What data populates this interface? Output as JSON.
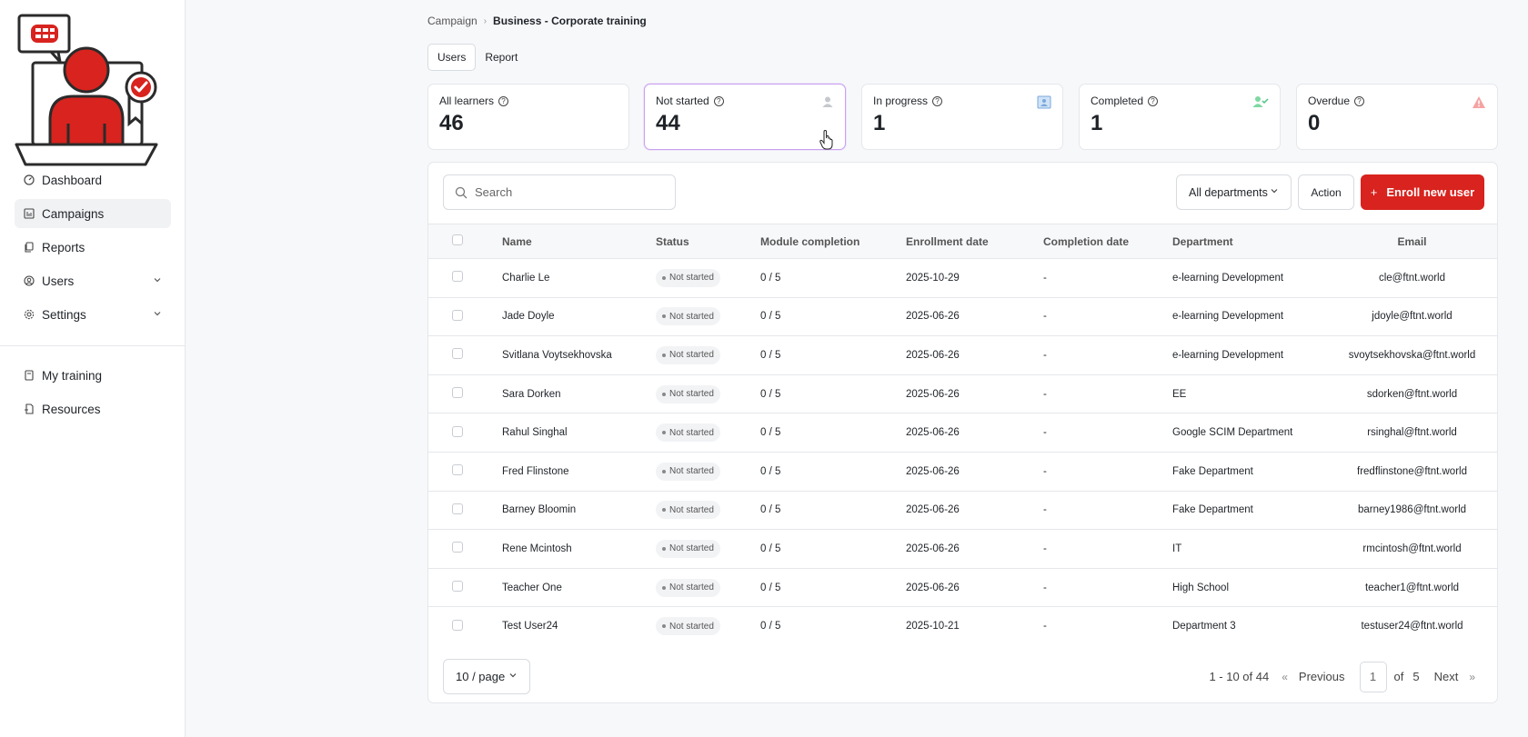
{
  "sidebar": {
    "items": [
      {
        "label": "Dashboard",
        "icon": "gauge-icon"
      },
      {
        "label": "Campaigns",
        "icon": "bar-chart-icon"
      },
      {
        "label": "Reports",
        "icon": "copy-icon"
      },
      {
        "label": "Users",
        "icon": "user-circle-icon"
      },
      {
        "label": "Settings",
        "icon": "gear-icon"
      }
    ],
    "secondary": [
      {
        "label": "My training",
        "icon": "book-icon"
      },
      {
        "label": "Resources",
        "icon": "file-icon"
      }
    ]
  },
  "breadcrumb": {
    "root": "Campaign",
    "current": "Business - Corporate training"
  },
  "tabs": [
    {
      "label": "Users"
    },
    {
      "label": "Report"
    }
  ],
  "stats": [
    {
      "label": "All learners",
      "value": "46"
    },
    {
      "label": "Not started",
      "value": "44"
    },
    {
      "label": "In progress",
      "value": "1"
    },
    {
      "label": "Completed",
      "value": "1"
    },
    {
      "label": "Overdue",
      "value": "0"
    }
  ],
  "toolbar": {
    "search_placeholder": "Search",
    "dept_label": "All departments",
    "action_label": "Action",
    "enroll_label": "Enroll new user",
    "enroll_plus": "+"
  },
  "table": {
    "headers": [
      "Name",
      "Status",
      "Module completion",
      "Enrollment date",
      "Completion date",
      "Department",
      "Email"
    ],
    "rows": [
      [
        "Charlie Le",
        "Not started",
        "0 / 5",
        "2025-10-29",
        "-",
        "e-learning Development",
        "cle@ftnt.world"
      ],
      [
        "Jade Doyle",
        "Not started",
        "0 / 5",
        "2025-06-26",
        "-",
        "e-learning Development",
        "jdoyle@ftnt.world"
      ],
      [
        "Svitlana Voytsekhovska",
        "Not started",
        "0 / 5",
        "2025-06-26",
        "-",
        "e-learning Development",
        "svoytsekhovska@ftnt.world"
      ],
      [
        "Sara Dorken",
        "Not started",
        "0 / 5",
        "2025-06-26",
        "-",
        "EE",
        "sdorken@ftnt.world"
      ],
      [
        "Rahul Singhal",
        "Not started",
        "0 / 5",
        "2025-06-26",
        "-",
        "Google SCIM Department",
        "rsinghal@ftnt.world"
      ],
      [
        "Fred Flinstone",
        "Not started",
        "0 / 5",
        "2025-06-26",
        "-",
        "Fake Department",
        "fredflinstone@ftnt.world"
      ],
      [
        "Barney Bloomin",
        "Not started",
        "0 / 5",
        "2025-06-26",
        "-",
        "Fake Department",
        "barney1986@ftnt.world"
      ],
      [
        "Rene Mcintosh",
        "Not started",
        "0 / 5",
        "2025-06-26",
        "-",
        "IT",
        "rmcintosh@ftnt.world"
      ],
      [
        "Teacher One",
        "Not started",
        "0 / 5",
        "2025-06-26",
        "-",
        "High School",
        "teacher1@ftnt.world"
      ],
      [
        "Test User24",
        "Not started",
        "0 / 5",
        "2025-10-21",
        "-",
        "Department 3",
        "testuser24@ftnt.world"
      ]
    ]
  },
  "footer": {
    "per_page": "10 / page",
    "range": "1 - 10 of 44",
    "previous": "Previous",
    "page": "1",
    "of": "of",
    "total_pages": "5",
    "next": "Next"
  },
  "colors": {
    "brand": "#d8231e",
    "highlight_border": "#c9a0f0"
  }
}
